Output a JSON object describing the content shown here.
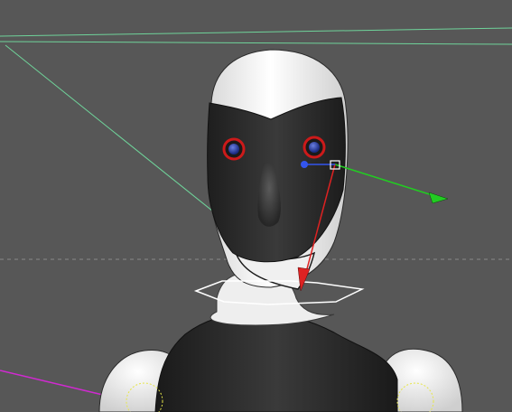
{
  "viewport": {
    "mode": "perspective-3d",
    "background_color": "#575757",
    "overlay_text": []
  },
  "scene": {
    "subject": "humanoid-robot-model",
    "colors": {
      "shell_white": "#f4f4f4",
      "face_plate_dark": "#2c2c2c",
      "eye_ring_red": "#cc1a1a",
      "eye_blue": "#2b3fa0",
      "guide_line_green": "#6fd39a",
      "guide_line_magenta": "#d02ad0",
      "horizon_dashes": "#8a8a8a"
    }
  },
  "gizmo": {
    "type": "move-translate",
    "axes": [
      {
        "axis": "x",
        "color": "#22cc22"
      },
      {
        "axis": "y",
        "color": "#dd2222"
      },
      {
        "axis": "z",
        "color": "#3355ee"
      }
    ]
  },
  "selection": {
    "neck_ring": {
      "color": "#ffffff"
    },
    "shoulder_pivots": {
      "color": "#e6e64a"
    }
  }
}
